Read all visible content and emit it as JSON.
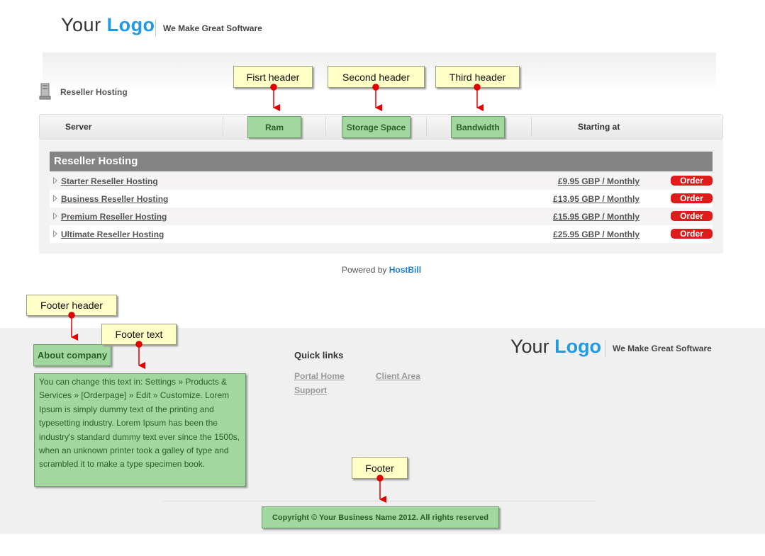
{
  "header": {
    "logo_prefix": "Your",
    "logo_accent": "Logo",
    "tagline": "We Make Great Software"
  },
  "section": {
    "icon": "server-icon",
    "label": "Reseller Hosting"
  },
  "columns": {
    "server": "Server",
    "ram": "Ram",
    "storage": "Storage Space",
    "bandwidth": "Bandwidth",
    "starting": "Starting at"
  },
  "callouts": {
    "first_header": "Fisrt header",
    "second_header": "Second header",
    "third_header": "Third header",
    "footer_header": "Footer header",
    "footer_text": "Footer text",
    "footer": "Footer"
  },
  "category": {
    "title": "Reseller Hosting",
    "products": [
      {
        "name": "Starter Reseller Hosting",
        "price": "£9.95 GBP / Monthly",
        "order": "Order"
      },
      {
        "name": "Business Reseller Hosting",
        "price": "£13.95 GBP / Monthly",
        "order": "Order"
      },
      {
        "name": "Premium Reseller Hosting",
        "price": "£15.95 GBP / Monthly",
        "order": "Order"
      },
      {
        "name": "Ultimate Reseller Hosting",
        "price": "£25.95 GBP / Monthly",
        "order": "Order"
      }
    ]
  },
  "powered": {
    "prefix": "Powered by",
    "brand": "HostBill"
  },
  "footer": {
    "about_title": "About company",
    "about_text": "You can change this text in: Settings » Products & Services » [Orderpage] » Edit » Customize. Lorem Ipsum is simply dummy text of the printing and typesetting industry. Lorem Ipsum has been the industry's standard dummy text ever since the 1500s, when an unknown printer took a galley of type and scrambled it to make a type specimen book.",
    "quick_links_title": "Quick links",
    "links": [
      "Portal Home",
      "Client Area",
      "Support"
    ],
    "logo_prefix": "Your",
    "logo_accent": "Logo",
    "tagline": "We Make Great Software",
    "copyright": "Copyright © Your Business Name 2012. All rights reserved"
  },
  "colors": {
    "accent_blue": "#1e9be3",
    "order_red": "#e01b1b",
    "highlight_green": "#a3d7a0",
    "callout_yellow": "#ffffc8",
    "arrow_red": "#e00000"
  }
}
